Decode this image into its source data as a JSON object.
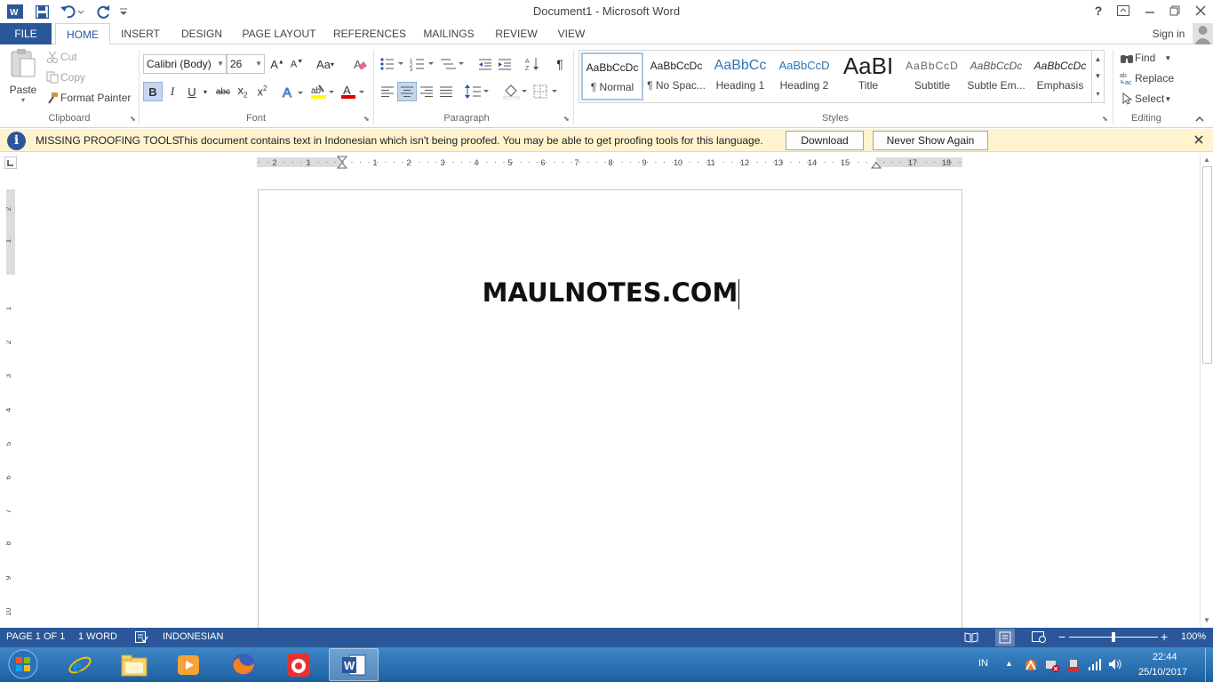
{
  "window": {
    "title": "Document1 - Microsoft Word",
    "help": "?"
  },
  "tabs": [
    "FILE",
    "HOME",
    "INSERT",
    "DESIGN",
    "PAGE LAYOUT",
    "REFERENCES",
    "MAILINGS",
    "REVIEW",
    "VIEW"
  ],
  "account": {
    "sign_in": "Sign in"
  },
  "ribbon": {
    "clipboard": {
      "paste": "Paste",
      "cut": "Cut",
      "copy": "Copy",
      "format_painter": "Format Painter",
      "label": "Clipboard"
    },
    "font": {
      "name": "Calibri (Body)",
      "size": "26",
      "label": "Font",
      "change_case": "Aa"
    },
    "paragraph": {
      "label": "Paragraph"
    },
    "styles": {
      "label": "Styles",
      "items": [
        {
          "sample": "AaBbCcDc",
          "name": "¶ Normal"
        },
        {
          "sample": "AaBbCcDc",
          "name": "¶ No Spac..."
        },
        {
          "sample": "AaBbCc",
          "name": "Heading 1"
        },
        {
          "sample": "AaBbCcD",
          "name": "Heading 2"
        },
        {
          "sample": "AaBI",
          "name": "Title"
        },
        {
          "sample": "AaBbCcD",
          "name": "Subtitle"
        },
        {
          "sample": "AaBbCcDc",
          "name": "Subtle Em..."
        },
        {
          "sample": "AaBbCcDc",
          "name": "Emphasis"
        }
      ]
    },
    "editing": {
      "find": "Find",
      "replace": "Replace",
      "select": "Select",
      "label": "Editing"
    }
  },
  "message_bar": {
    "title": "MISSING PROOFING TOOLS",
    "text": "This document contains text in Indonesian which isn't being proofed. You may be able to get proofing tools for this language.",
    "download": "Download",
    "never_show": "Never Show Again"
  },
  "ruler": {
    "h_labels": [
      "2",
      "1",
      "1",
      "2",
      "3",
      "4",
      "5",
      "6",
      "7",
      "8",
      "9",
      "10",
      "11",
      "12",
      "13",
      "14",
      "15",
      "17",
      "18"
    ],
    "v_labels": [
      "2",
      "1",
      "1",
      "2",
      "3",
      "4",
      "5",
      "6",
      "7",
      "8",
      "9",
      "10"
    ]
  },
  "document": {
    "text": "MAULNOTES.COM"
  },
  "status": {
    "page": "PAGE 1 OF 1",
    "words": "1 WORD",
    "language": "INDONESIAN",
    "zoom": "100%"
  },
  "taskbar": {
    "lang": "IN",
    "time": "22:44",
    "date": "25/10/2017"
  },
  "colors": {
    "accent": "#2b579a",
    "message_bar": "#fff4ce",
    "taskbar": "#1c5fa0"
  }
}
